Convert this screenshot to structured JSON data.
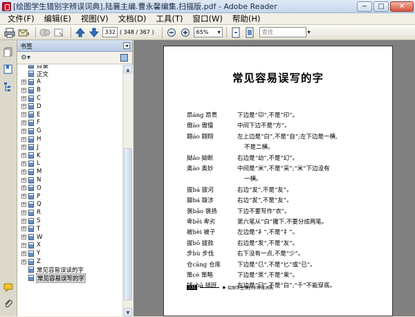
{
  "window": {
    "title": "[绘图学生错别字辨误词典].陆襄主编.曹永馨编集.扫描版.pdf - Adobe Reader",
    "min": "−",
    "max": "□",
    "close": "✕"
  },
  "menu": [
    "文件(F)",
    "编辑(E)",
    "视图(V)",
    "文档(D)",
    "工具(T)",
    "窗口(W)",
    "帮助(H)"
  ],
  "toolbar": {
    "page_value": "332",
    "page_count": "( 348 / 367 )",
    "zoom": "65%",
    "find_placeholder": "查找"
  },
  "bookmarks_panel": {
    "title": "书签",
    "items": [
      {
        "label": "目录",
        "exp": false
      },
      {
        "label": "正文",
        "exp": false
      },
      {
        "label": "A",
        "exp": true
      },
      {
        "label": "B",
        "exp": true
      },
      {
        "label": "C",
        "exp": true
      },
      {
        "label": "D",
        "exp": true
      },
      {
        "label": "E",
        "exp": true
      },
      {
        "label": "F",
        "exp": true
      },
      {
        "label": "G",
        "exp": true
      },
      {
        "label": "H",
        "exp": true
      },
      {
        "label": "J",
        "exp": true
      },
      {
        "label": "K",
        "exp": true
      },
      {
        "label": "L",
        "exp": true
      },
      {
        "label": "M",
        "exp": true
      },
      {
        "label": "N",
        "exp": true
      },
      {
        "label": "O",
        "exp": true
      },
      {
        "label": "P",
        "exp": true
      },
      {
        "label": "Q",
        "exp": true
      },
      {
        "label": "R",
        "exp": true
      },
      {
        "label": "S",
        "exp": true
      },
      {
        "label": "T",
        "exp": true
      },
      {
        "label": "W",
        "exp": true
      },
      {
        "label": "X",
        "exp": true
      },
      {
        "label": "Y",
        "exp": true
      },
      {
        "label": "Z",
        "exp": true
      },
      {
        "label": "常见容易误读的字",
        "exp": false
      },
      {
        "label": "常见容易误写的字",
        "exp": false,
        "selected": true
      }
    ]
  },
  "document": {
    "heading": "常见容易误写的字",
    "entries": [
      {
        "word": "昂áng 昂贵",
        "desc": "下边是“卬”,不是“印”。"
      },
      {
        "word": "傲ào 傲慢",
        "desc": "中间下边不是“方”。"
      },
      {
        "word": "翱áo 翱翔",
        "desc": "左上边是“白”,不是“自”;左下边是一横,"
      },
      {
        "word": "",
        "desc": "不是二横。"
      },
      {
        "word": "拗ǎo 拗断",
        "desc": "右边是“幼”,不是“幻”。"
      },
      {
        "word": "奥ào 奥妙",
        "desc": "中间是“米”,不是“采”;“米”下边没有"
      },
      {
        "word": "",
        "desc": "一横。"
      },
      {
        "word": "拔bá 拔河",
        "desc": "右边“犮”,不是“友”。"
      },
      {
        "word": "跋bá 跋涉",
        "desc": "右边“犮”,不是“友”。"
      },
      {
        "word": "褒bāo 褒扬",
        "desc": "下边不要写作“衣”。"
      },
      {
        "word": "卑bēi 卑劣",
        "desc": "第六笔从“白”撇下,不要分成两笔。"
      },
      {
        "word": "被bèi 被子",
        "desc": "左边是“衤”,不是“礻”。"
      },
      {
        "word": "拔bō 拔款",
        "desc": "右边是“发”,不是“友”。"
      },
      {
        "word": "步bù 步伐",
        "desc": "右下没有一点,不是“少”。"
      },
      {
        "word": "仓cāng 仓库",
        "desc": "下边是“㔾”,不是“匕”或“已”。"
      },
      {
        "word": "策cè 策略",
        "desc": "下边是“朿”,不是“束”。"
      },
      {
        "word": "插chā 插班",
        "desc": "左边是“臼”,不是“白”;“千”不能穿底。"
      }
    ],
    "footer_page": "331",
    "footer_text": "绘图学生错别字辨误词典"
  }
}
